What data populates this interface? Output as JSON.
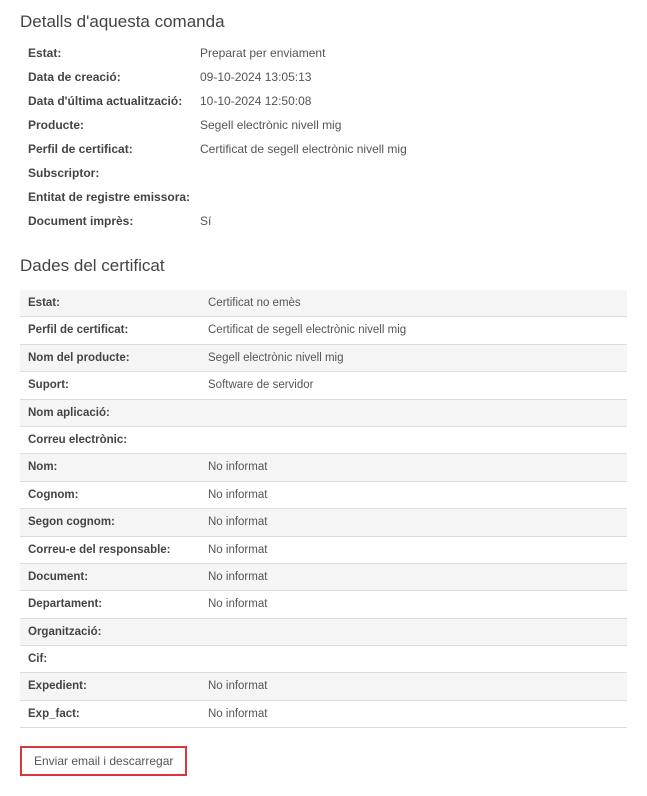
{
  "order_details": {
    "title": "Detalls d'aquesta comanda",
    "rows": [
      {
        "label": "Estat:",
        "value": "Preparat per enviament"
      },
      {
        "label": "Data de creació:",
        "value": "09-10-2024 13:05:13"
      },
      {
        "label": "Data d'última actualització:",
        "value": "10-10-2024 12:50:08"
      },
      {
        "label": "Producte:",
        "value": "Segell electrònic nivell mig"
      },
      {
        "label": "Perfil de certificat:",
        "value": "Certificat de segell electrònic nivell mig"
      },
      {
        "label": "Subscriptor:",
        "value": ""
      },
      {
        "label": "Entitat de registre emissora:",
        "value": ""
      },
      {
        "label": "Document imprès:",
        "value": "Sí"
      }
    ]
  },
  "certificate_data": {
    "title": "Dades del certificat",
    "rows": [
      {
        "label": "Estat:",
        "value": "Certificat no emès"
      },
      {
        "label": "Perfil de certificat:",
        "value": "Certificat de segell electrònic nivell mig"
      },
      {
        "label": "Nom del producte:",
        "value": "Segell electrònic nivell mig"
      },
      {
        "label": "Suport:",
        "value": "Software de servidor"
      },
      {
        "label": "Nom aplicació:",
        "value": ""
      },
      {
        "label": "Correu electrònic:",
        "value": ""
      },
      {
        "label": "Nom:",
        "value": "No informat"
      },
      {
        "label": "Cognom:",
        "value": "No informat"
      },
      {
        "label": "Segon cognom:",
        "value": "No informat"
      },
      {
        "label": "Correu-e del responsable:",
        "value": "No informat"
      },
      {
        "label": "Document:",
        "value": "No informat"
      },
      {
        "label": "Departament:",
        "value": "No informat"
      },
      {
        "label": "Organització:",
        "value": ""
      },
      {
        "label": "Cif:",
        "value": ""
      },
      {
        "label": "Expedient:",
        "value": "No informat"
      },
      {
        "label": "Exp_fact:",
        "value": "No informat"
      }
    ]
  },
  "actions": {
    "send_email_download": "Enviar email i descarregar"
  }
}
